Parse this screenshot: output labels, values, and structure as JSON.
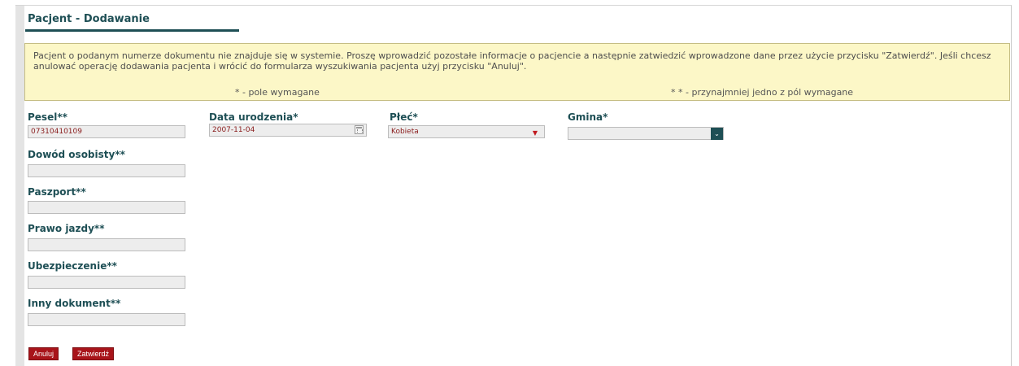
{
  "page": {
    "title": "Pacjent - Dodawanie"
  },
  "info": {
    "message": "Pacjent o podanym numerze dokumentu nie znajduje się w systemie. Proszę wprowadzić pozostałe informacje o pacjencie a następnie zatwiedzić wprowadzone dane przez użycie przycisku \"Zatwierdź\". Jeśli chcesz anulować operację dodawania pacjenta i wrócić do formularza wyszukiwania pacjenta użyj przycisku \"Anuluj\".",
    "required_note": "* - pole wymagane",
    "one_of_note": "* * - przynajmniej jedno z pól wymagane"
  },
  "form": {
    "pesel": {
      "label": "Pesel**",
      "value": "07310410109"
    },
    "birth_date": {
      "label": "Data urodzenia*",
      "value": "2007-11-04",
      "icon": "calendar-icon"
    },
    "sex": {
      "label": "Płeć*",
      "value": "Kobieta",
      "icon": "dropdown-arrow-icon"
    },
    "municipality": {
      "label": "Gmina*",
      "value": "",
      "icon": "chevron-down-icon"
    },
    "id_card": {
      "label": "Dowód osobisty**",
      "value": ""
    },
    "passport": {
      "label": "Paszport**",
      "value": ""
    },
    "driving_license": {
      "label": "Prawo jazdy**",
      "value": ""
    },
    "insurance": {
      "label": "Ubezpieczenie**",
      "value": ""
    },
    "other_document": {
      "label": "Inny dokument**",
      "value": ""
    }
  },
  "buttons": {
    "cancel": "Anuluj",
    "submit": "Zatwierdź"
  },
  "colors": {
    "heading": "#1e4f55",
    "button": "#a8141a",
    "info_bg": "#fcf7c7",
    "value_text": "#8a1c1c"
  }
}
